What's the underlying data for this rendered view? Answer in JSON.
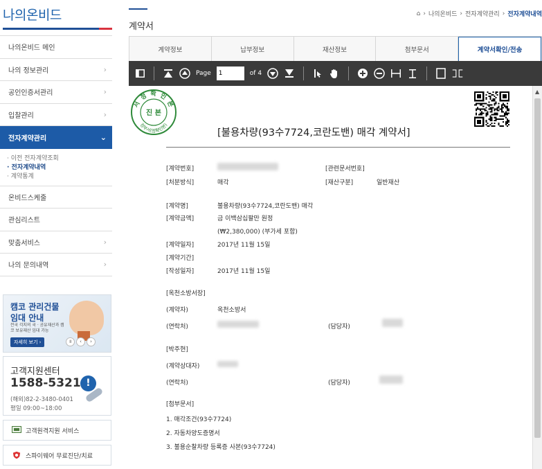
{
  "sidebar": {
    "logo": "나의온비드",
    "menu": [
      {
        "label": "나의온비드 메인"
      },
      {
        "label": "나의 정보관리",
        "chevron": "›"
      },
      {
        "label": "공인인증서관리",
        "chevron": "›"
      },
      {
        "label": "입찰관리",
        "chevron": "›"
      },
      {
        "label": "전자계약관리",
        "chevron": "⌄"
      }
    ],
    "submenu": [
      "· 이전 전자계약조회",
      "· 전자계약내역",
      "· 계약통계"
    ],
    "menu2": [
      {
        "label": "온비드스케줄"
      },
      {
        "label": "관심리스트"
      },
      {
        "label": "맞춤서비스",
        "chevron": "›"
      },
      {
        "label": "나의 문의내역",
        "chevron": "›"
      }
    ],
    "banner": {
      "title1": "캠코 관리건물",
      "title2": "임대 안내",
      "desc": "전국 각지의 국 · 공유재산과 캠코 보유재산 임대 가능",
      "button": "자세히 보기 ›"
    },
    "support": {
      "title": "고객지원센터",
      "phone": "1588-5321",
      "overseas": "(해외)82-2-3480-0401",
      "hours": "평일 09:00~18:00"
    },
    "remote_service": "고객원격지원 서비스",
    "spyware_check": "스파이웨어 무료진단/치료"
  },
  "main": {
    "page_title": "계약서",
    "breadcrumb": [
      "⌂",
      "›",
      "나의온비드",
      "›",
      "전자계약관리",
      "›",
      "전자계약내역"
    ],
    "tabs": [
      {
        "label": "계약정보"
      },
      {
        "label": "납부정보"
      },
      {
        "label": "재산정보"
      },
      {
        "label": "첨부문서"
      },
      {
        "label": "계약서확인/전송"
      }
    ]
  },
  "viewer": {
    "page_label": "Page",
    "page_value": "1",
    "of_label": "of 4"
  },
  "document": {
    "seal_top": "서 정 확 인 본",
    "seal_center": "진 본",
    "seal_bottom": "정부서(정확인본)",
    "title": "[불용차량(93수7724,코란도밴) 매각 계약서]",
    "contract_no_label": "[계약번호]",
    "related_doc_label": "[관련문서번호]",
    "disposal_label": "[처분방식]",
    "disposal_value": "매각",
    "asset_type_label": "[재산구분]",
    "asset_type_value": "일반재산",
    "contract_name_label": "[계약명]",
    "contract_name_value": "불용차량(93수7724,코란도밴) 매각",
    "amount_label": "[계약금액]",
    "amount_value": "금 이백삼십팔만 원정",
    "amount_detail": "(₩2,380,000) (부가세 포함)",
    "contract_date_label": "[계약일자]",
    "contract_date_value": "2017년 11월 15일",
    "period_label": "[계약기간]",
    "written_date_label": "[작성일자]",
    "written_date_value": "2017년 11월 15일",
    "party1_header": "[옥천소방서장]",
    "party1_contractor_label": "(계약자)",
    "party1_contractor_value": "옥천소방서",
    "party1_contact_label": "(연락처)",
    "party1_manager_label": "(담당자)",
    "party2_header": "[박주현]",
    "party2_counterpart_label": "(계약상대자)",
    "party2_contact_label": "(연락처)",
    "party2_manager_label": "(담당자)",
    "attachments_header": "[첨부문서]",
    "attachments": [
      "1. 매각조건(93수7724)",
      "2. 자동차양도증명서",
      "3. 불용순찰차량 등록증 사본(93수7724)"
    ]
  },
  "colors": {
    "brand_blue": "#1d5ba7",
    "brand_red": "#d9333f",
    "toolbar": "#3a3a3a"
  },
  "icons": [
    "sidebar-toggle-icon",
    "first-page-icon",
    "prev-page-icon",
    "next-page-icon",
    "last-page-icon",
    "text-select-icon",
    "hand-tool-icon",
    "zoom-in-icon",
    "zoom-out-icon",
    "fit-width-icon",
    "fit-height-icon",
    "single-page-icon",
    "two-page-icon"
  ]
}
